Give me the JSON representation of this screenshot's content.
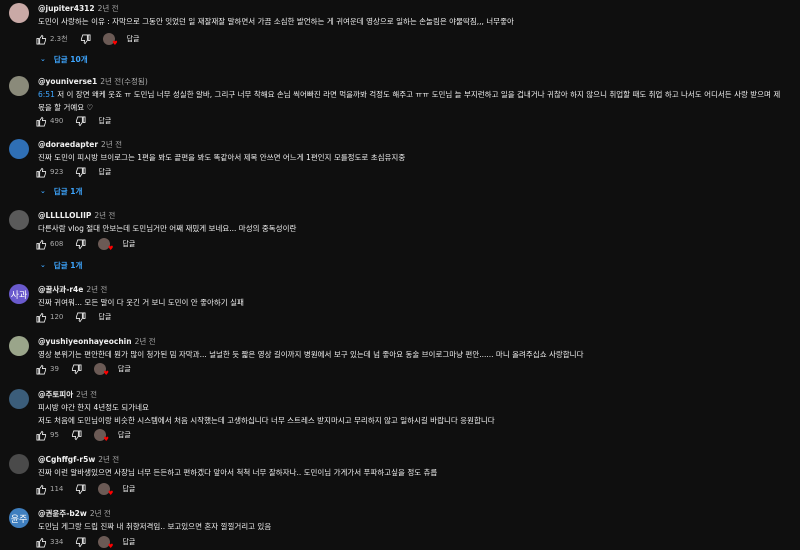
{
  "comments": [
    {
      "author": "@jupiter4312",
      "time": "2년 전",
      "text": "도민이 사랑하는 이유 : 자막으로 그동안 잇었던 일 재잘재잘 말하면서 가끔 소심한 발언하는 게 귀여운데 영상으로 일하는 손놀림은 야물딱짐,,, 너무좋아",
      "timestamp": "",
      "likes": "2.3천",
      "reply_label": "답글",
      "replies": "답글 10개",
      "avatar_color": "#c9a9a6"
    },
    {
      "author": "@youniverse1",
      "time": "2년 전(수정됨)",
      "timestamp": "6:51",
      "text": "저 이 장면 왜케 웃죠 ㅠ 도민님 너무 성실한 알바, 그리구 너무 착해요 손님 씩어빠진 라면 먹을까봐 걱정도 해주고 ㅠㅠ 도민님 늘 부지런하고 일을 겁내거나 귀찮아 하지 않으니 취업할 때도 취업 하고 나서도 어디서든 사랑 받으며 제 몫을 할 거예요 ♡",
      "likes": "490",
      "reply_label": "답글",
      "replies": "",
      "avatar_color": "#8a8a7a"
    },
    {
      "author": "@doraedapter",
      "time": "2년 전",
      "timestamp": "",
      "text": "진짜 도민이 피시방 브이로그는 1편을 봐도 끝편을 봐도 똑같아서 제목 안쓰면 어느게 1편인지 모를정도로 초심유지중",
      "likes": "923",
      "reply_label": "답글",
      "replies": "답글 1개",
      "avatar_color": "#2f6fb5"
    },
    {
      "author": "@LLLLLOLIIP",
      "time": "2년 전",
      "timestamp": "",
      "text": "다른사람 vlog 절대 안보는데 도민님거만 어째 재밌게 보네요... 마성의 중독성이란",
      "likes": "608",
      "reply_label": "답글",
      "replies": "답글 1개",
      "avatar_color": "#5a5a5a"
    },
    {
      "author": "@꿀사과-r4e",
      "time": "2년 전",
      "timestamp": "",
      "text": "진짜 귀여워... 모든 말이 다 웃긴 거 보니 도민이 안 좋아하기 실패",
      "likes": "120",
      "reply_label": "답글",
      "replies": "",
      "avatar_color": "#6a5acd",
      "avatar_text": "사과"
    },
    {
      "author": "@yushiyeonhayeochin",
      "time": "2년 전",
      "timestamp": "",
      "text": "영상 분위기는 편안한데 뭔가 많이 청가된 밈 자막과... 널널한 듯 짧은 영상 길이까지 병원에서 보구 있는데 넘 좋아요 동술 브이로그마냥 편안...... 마니 올려주십쇼 사랑합니다",
      "likes": "39",
      "reply_label": "답글",
      "replies": "",
      "avatar_color": "#9aa58a"
    },
    {
      "author": "@주토피아",
      "time": "2년 전",
      "timestamp": "",
      "text": "피시방 야간 한지 4년정도 되가네요\n저도 처음에 도민님이랑 비슷한 시스템에서 처음 시작했는데 고생하십니다 너무 스트레스 받지마시고 무리하지 않고 일하시길 바랍니다 응원합니다",
      "likes": "95",
      "reply_label": "답글",
      "replies": "",
      "avatar_color": "#3b5d7a"
    },
    {
      "author": "@Cghffgf-r5w",
      "time": "2년 전",
      "timestamp": "",
      "text": "진짜 이런 알바생있으면 사장님 너무 든든하고 편하겠다 앞아서 척척 너무 잘하자나.. 도민이님 가게가서 푸파하고싶을 정도 츄릅",
      "likes": "114",
      "reply_label": "답글",
      "replies": "",
      "avatar_color": "#4a4a4a"
    },
    {
      "author": "@권윤주-b2w",
      "time": "2년 전",
      "timestamp": "",
      "text": "도민님 게그랑 드립 진짜 내 취향저격임.. 보고있으면 혼자 낄낄거리고 있음",
      "likes": "334",
      "reply_label": "답글",
      "replies": "",
      "avatar_color": "#3f7fbf",
      "avatar_text": "윤주"
    }
  ]
}
